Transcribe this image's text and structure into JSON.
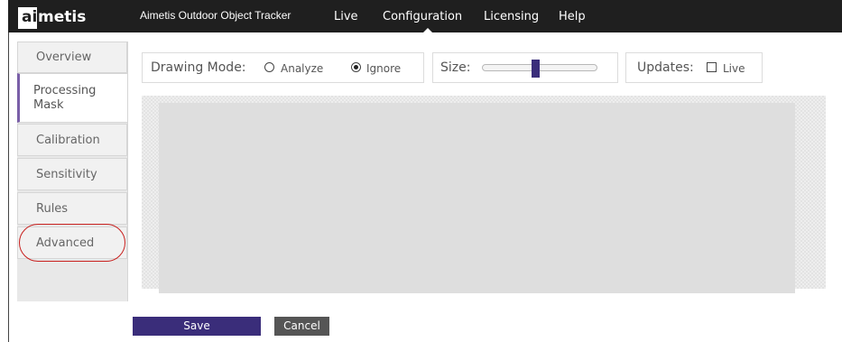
{
  "header": {
    "logo_ai": "ai",
    "logo_rest": "metis",
    "app_title": "Aimetis Outdoor Object Tracker",
    "nav": [
      "Live",
      "Configuration",
      "Licensing",
      "Help"
    ],
    "active_nav": "Configuration"
  },
  "sidebar": {
    "tabs": [
      "Overview",
      "Processing Mask",
      "Calibration",
      "Sensitivity",
      "Rules",
      "Advanced"
    ],
    "active_tab": "Processing Mask",
    "highlighted_tab": "Advanced"
  },
  "toolbar": {
    "drawing_mode_label": "Drawing Mode:",
    "options": [
      {
        "label": "Analyze",
        "checked": false
      },
      {
        "label": "Ignore",
        "checked": true
      }
    ],
    "size_label": "Size:",
    "size_level": 0.46,
    "updates_label": "Updates:",
    "live_label": "Live",
    "live_checked": false
  },
  "actions": {
    "save_label": "Save",
    "cancel_label": "Cancel"
  },
  "colors": {
    "accent": "#3a2d7a",
    "active_tab_border": "#7a5fa8",
    "annotation": "#c8201e",
    "topbar": "#1f1f1f"
  }
}
